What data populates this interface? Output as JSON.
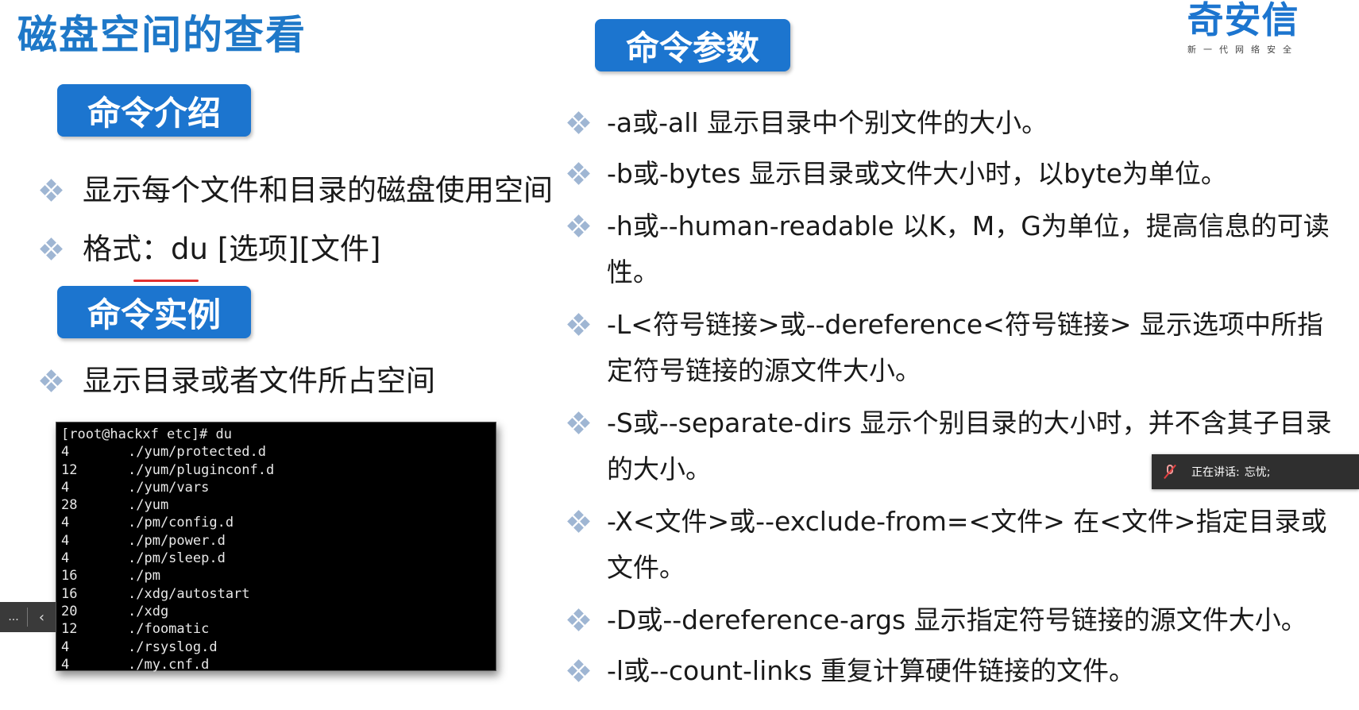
{
  "page_title": "磁盘空间的查看",
  "logo": {
    "main": "奇安信",
    "sub": "新一代网络安全"
  },
  "sections": {
    "intro": "命令介绍",
    "example": "命令实例",
    "params": "命令参数"
  },
  "intro_bullets": [
    "显示每个文件和目录的磁盘使用空间",
    "格式：du [选项][文件]"
  ],
  "example_bullets": [
    "显示目录或者文件所占空间"
  ],
  "terminal": {
    "prompt": "[root@hackxf etc]# du",
    "rows": [
      {
        "size": "4",
        "path": "./yum/protected.d"
      },
      {
        "size": "12",
        "path": "./yum/pluginconf.d"
      },
      {
        "size": "4",
        "path": "./yum/vars"
      },
      {
        "size": "28",
        "path": "./yum"
      },
      {
        "size": "4",
        "path": "./pm/config.d"
      },
      {
        "size": "4",
        "path": "./pm/power.d"
      },
      {
        "size": "4",
        "path": "./pm/sleep.d"
      },
      {
        "size": "16",
        "path": "./pm"
      },
      {
        "size": "16",
        "path": "./xdg/autostart"
      },
      {
        "size": "20",
        "path": "./xdg"
      },
      {
        "size": "12",
        "path": "./foomatic"
      },
      {
        "size": "4",
        "path": "./rsyslog.d"
      },
      {
        "size": "4",
        "path": "./my.cnf.d"
      }
    ]
  },
  "param_bullets": [
    "-a或-all  显示目录中个别文件的大小。",
    "-b或-bytes  显示目录或文件大小时，以byte为单位。",
    "-h或--human-readable  以K，M，G为单位，提高信息的可读性。",
    "-L<符号链接>或--dereference<符号链接> 显示选项中所指定符号链接的源文件大小。",
    "-S或--separate-dirs   显示个别目录的大小时，并不含其子目录的大小。",
    "-X<文件>或--exclude-from=<文件>  在<文件>指定目录或文件。",
    "-D或--dereference-args   显示指定符号链接的源文件大小。",
    "-l或--count-links   重复计算硬件链接的文件。"
  ],
  "left_nav": {
    "dots": "...",
    "chevron": "‹"
  },
  "speaker": {
    "label": "正在讲话:",
    "name": "忘忧;"
  },
  "colors": {
    "accent": "#1c75cf",
    "title": "#1e78c8",
    "bullet": "#9fb6d3"
  }
}
